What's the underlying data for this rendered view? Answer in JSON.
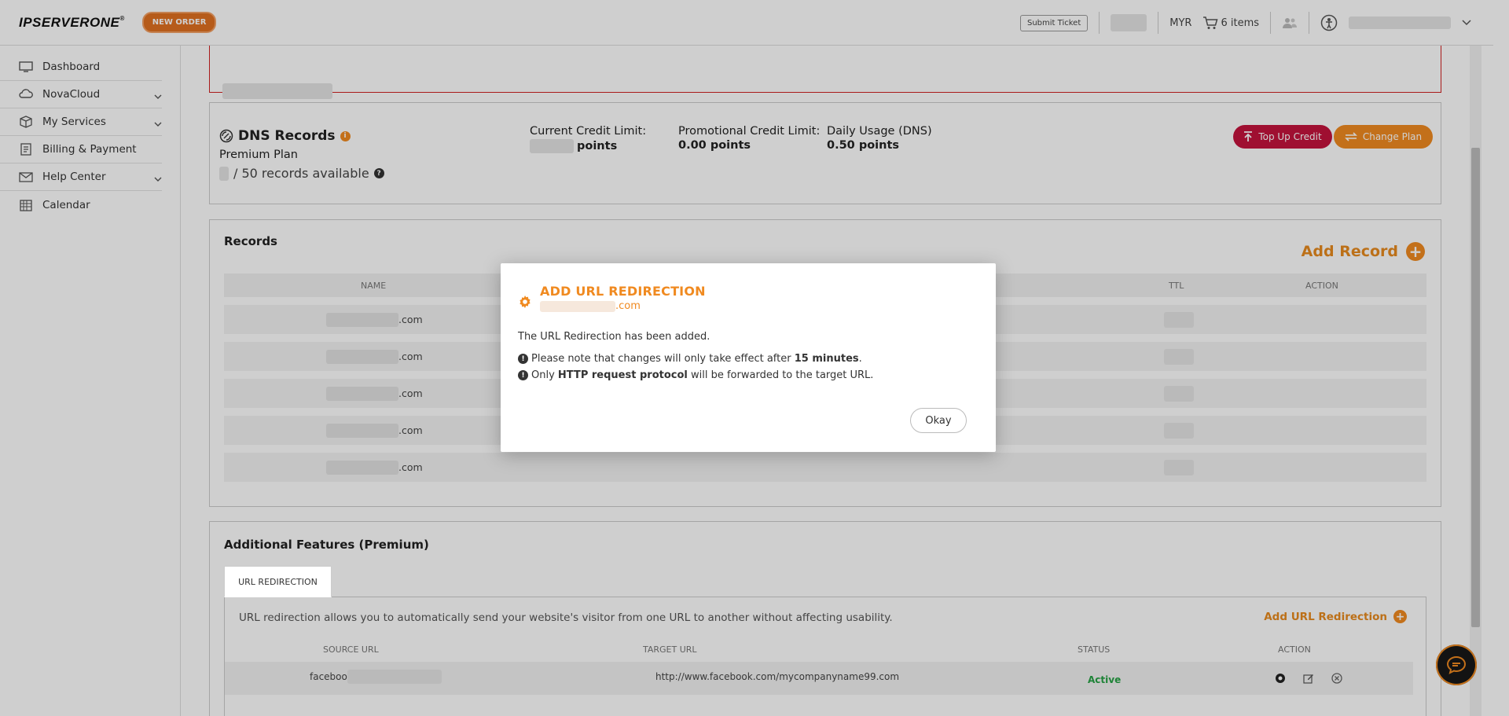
{
  "header": {
    "logo_text": "IPSERVERONE",
    "logo_mark": "®",
    "new_order_label": "NEW ORDER",
    "submit_ticket_label": "Submit Ticket",
    "currency": "MYR",
    "cart_label": "6 items"
  },
  "sidebar": {
    "items": [
      {
        "label": "Dashboard",
        "icon": "monitor-icon"
      },
      {
        "label": "NovaCloud",
        "icon": "cloud-icon"
      },
      {
        "label": "My Services",
        "icon": "box-icon"
      },
      {
        "label": "Billing & Payment",
        "icon": "billing-icon"
      },
      {
        "label": "Help Center",
        "icon": "mail-icon"
      },
      {
        "label": "Calendar",
        "icon": "calendar-icon"
      }
    ]
  },
  "dns": {
    "title": "DNS Records",
    "plan": "Premium Plan",
    "available": "/ 50 records available",
    "current_credit_label": "Current Credit Limit:",
    "current_credit_value": "points",
    "promo_credit_label": "Promotional Credit Limit:",
    "promo_credit_value": "0.00 points",
    "daily_usage_label": "Daily Usage (DNS)",
    "daily_usage_value": "0.50 points",
    "top_up_label": "Top Up Credit",
    "change_plan_label": "Change Plan"
  },
  "records": {
    "title": "Records",
    "add_label": "Add Record",
    "columns": [
      "NAME",
      "TTL",
      "ACTION"
    ],
    "rows": [
      {
        "domain": ".com"
      },
      {
        "domain": ".com"
      },
      {
        "domain": ".com"
      },
      {
        "domain": ".com"
      },
      {
        "domain": ".com"
      }
    ]
  },
  "features": {
    "title": "Additional Features (Premium)",
    "tab_label": "URL REDIRECTION",
    "description": "URL redirection allows you to automatically send your website's visitor from one URL to another without affecting usability.",
    "add_label": "Add URL Redirection",
    "columns": [
      "SOURCE URL",
      "TARGET URL",
      "STATUS",
      "ACTION"
    ],
    "row": {
      "source": "facebook.",
      "target": "http://www.facebook.com/mycompanyname99.com",
      "status": "Active"
    }
  },
  "modal": {
    "title": "ADD URL REDIRECTION",
    "domain_suffix": ".com",
    "message": "The URL Redirection has been added.",
    "note1_prefix": "Please note that changes will only take effect after ",
    "note1_bold": "15 minutes",
    "note1_suffix": ".",
    "note2_prefix": "Only ",
    "note2_bold": "HTTP request protocol",
    "note2_suffix": " will be forwarded to the target URL.",
    "okay_label": "Okay"
  },
  "colors": {
    "accent": "#f08a20",
    "danger": "#c4133d",
    "success": "#25a244"
  }
}
